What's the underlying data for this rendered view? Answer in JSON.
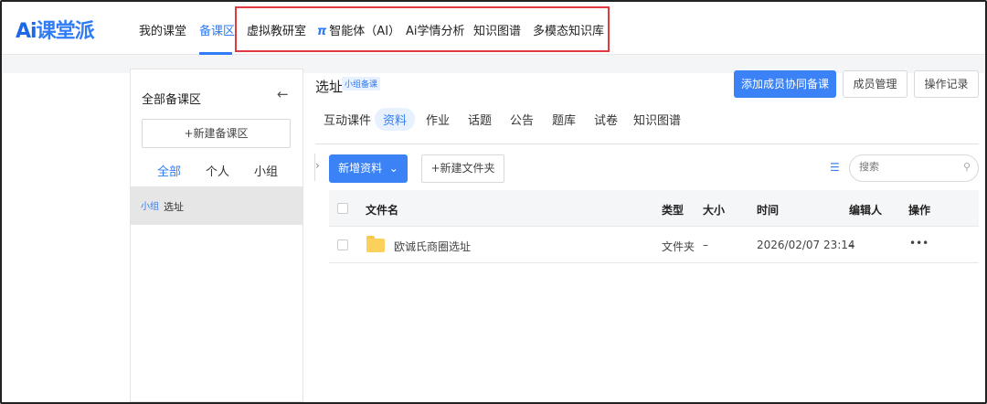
{
  "app": {
    "logo_prefix": "Ai",
    "logo_text": "课堂派"
  },
  "nav": {
    "items": [
      {
        "label": "我的课堂"
      },
      {
        "label": "备课区"
      },
      {
        "label": "虚拟教研室"
      },
      {
        "label": "智能体（AI）"
      },
      {
        "label": "Ai学情分析"
      },
      {
        "label": "知识图谱"
      },
      {
        "label": "多模态知识库"
      }
    ],
    "active": "备课区",
    "pi_icon": "π"
  },
  "sidebar": {
    "title": "全部备课区",
    "back_icon": "←",
    "new_button": "+新建备课区",
    "tabs": [
      {
        "label": "全部"
      },
      {
        "label": "个人"
      },
      {
        "label": "小组"
      }
    ],
    "items": [
      {
        "tag": "小组",
        "label": "选址"
      }
    ]
  },
  "main": {
    "title": "选址",
    "badge": "小组备课",
    "buttons": {
      "add_member": "添加成员协同备课",
      "member_manage": "成员管理",
      "op_log": "操作记录"
    },
    "tabs": [
      {
        "label": "互动课件"
      },
      {
        "label": "资料"
      },
      {
        "label": "作业"
      },
      {
        "label": "话题"
      },
      {
        "label": "公告"
      },
      {
        "label": "题库"
      },
      {
        "label": "试卷"
      },
      {
        "label": "知识图谱"
      }
    ],
    "active_tab": "资料",
    "toolbar": {
      "add_material": "新增资料",
      "new_folder": "+新建文件夹",
      "search_placeholder": "搜索"
    },
    "table": {
      "headers": {
        "name": "文件名",
        "type": "类型",
        "size": "大小",
        "time": "时间",
        "editor": "编辑人",
        "action": "操作"
      },
      "rows": [
        {
          "name": "欧诚氏商圈选址",
          "type": "文件夹",
          "size": "–",
          "time": "2026/02/07 23:14",
          "editor": "–",
          "action": "•••"
        }
      ]
    }
  },
  "colors": {
    "accent": "#2f7cf6",
    "highlight_box": "#e0393e",
    "folder": "#fbd15b"
  }
}
